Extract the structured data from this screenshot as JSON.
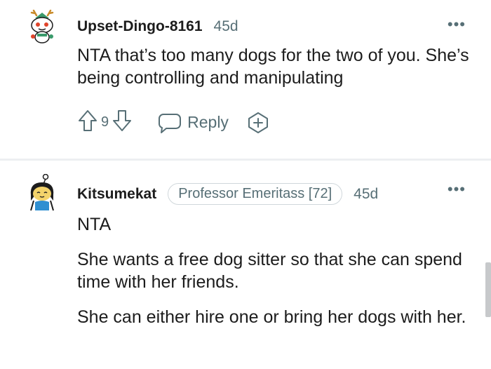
{
  "comments": [
    {
      "username": "Upset-Dingo-8161",
      "time": "45d",
      "body": [
        "NTA that’s too many dogs for the two of you. She’s being controlling and manipulating"
      ],
      "votes": "9",
      "reply_label": "Reply"
    },
    {
      "username": "Kitsumekat",
      "flair": "Professor Emeritass [72]",
      "time": "45d",
      "body": [
        "NTA",
        "She wants a free dog sitter so that she can spend time with her friends.",
        "She can either hire one or bring her dogs with her."
      ]
    }
  ],
  "more_label": "•••",
  "icons": {
    "upvote": "arrow-up-icon",
    "downvote": "arrow-down-icon",
    "reply": "speech-bubble-icon",
    "award": "award-plus-icon",
    "more": "more-dots-icon"
  }
}
